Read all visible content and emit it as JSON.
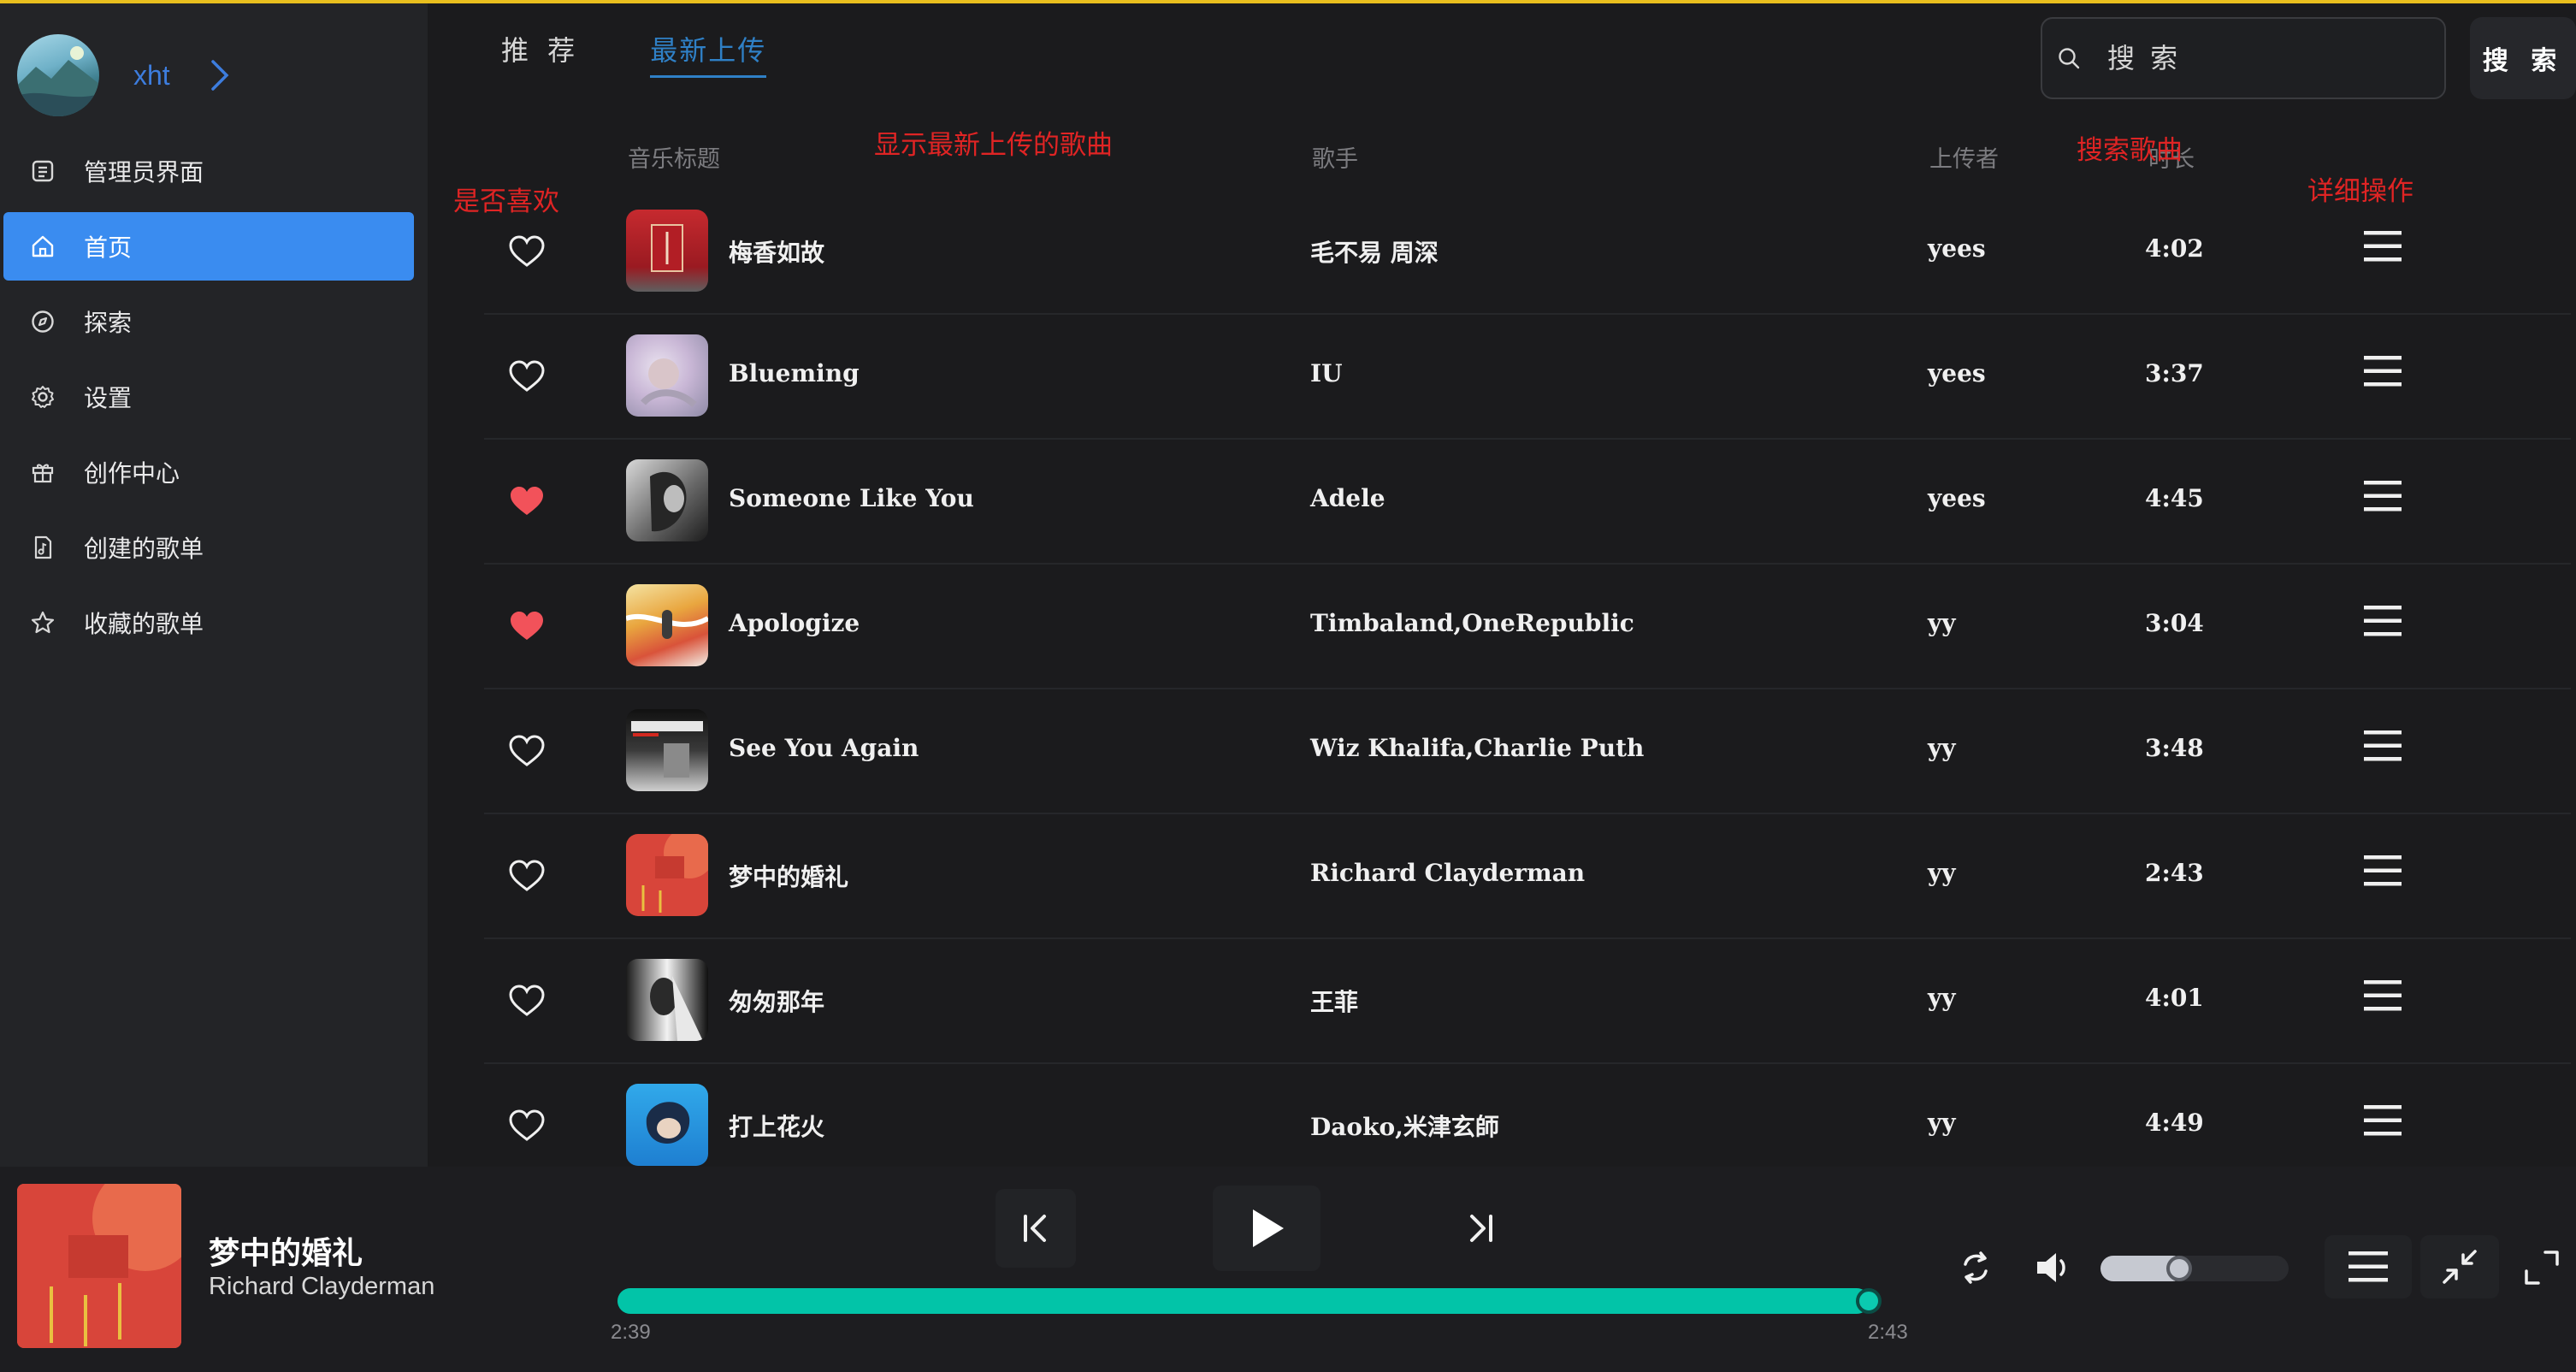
{
  "sidebar": {
    "username": "xht",
    "items": [
      {
        "label": "管理员界面",
        "icon": "admin-list-icon",
        "active": false
      },
      {
        "label": "首页",
        "icon": "home-icon",
        "active": true
      },
      {
        "label": "探索",
        "icon": "compass-icon",
        "active": false
      },
      {
        "label": "设置",
        "icon": "gear-icon",
        "active": false
      },
      {
        "label": "创作中心",
        "icon": "gift-icon",
        "active": false
      },
      {
        "label": "创建的歌单",
        "icon": "music-doc-icon",
        "active": false
      },
      {
        "label": "收藏的歌单",
        "icon": "star-icon",
        "active": false
      }
    ]
  },
  "tabs": [
    {
      "label": "推 荐",
      "active": false
    },
    {
      "label": "最新上传",
      "active": true
    }
  ],
  "search": {
    "placeholder": "搜 索",
    "button_label": "搜 索"
  },
  "table": {
    "headers": {
      "title": "音乐标题",
      "artist": "歌手",
      "uploader": "上传者",
      "duration": "时长"
    },
    "rows": [
      {
        "title": "梅香如故",
        "artist": "毛不易 周深",
        "uploader": "yees",
        "duration": "4:02",
        "liked": false
      },
      {
        "title": "Blueming",
        "artist": "IU",
        "uploader": "yees",
        "duration": "3:37",
        "liked": false
      },
      {
        "title": "Someone Like You",
        "artist": "Adele",
        "uploader": "yees",
        "duration": "4:45",
        "liked": true
      },
      {
        "title": "Apologize",
        "artist": "Timbaland,OneRepublic",
        "uploader": "yy",
        "duration": "3:04",
        "liked": true
      },
      {
        "title": "See You Again",
        "artist": "Wiz Khalifa,Charlie Puth",
        "uploader": "yy",
        "duration": "3:48",
        "liked": false
      },
      {
        "title": "梦中的婚礼",
        "artist": "Richard Clayderman",
        "uploader": "yy",
        "duration": "2:43",
        "liked": false
      },
      {
        "title": "匆匆那年",
        "artist": "王菲",
        "uploader": "yy",
        "duration": "4:01",
        "liked": false
      },
      {
        "title": "打上花火",
        "artist": "Daoko,米津玄師",
        "uploader": "yy",
        "duration": "4:49",
        "liked": false
      }
    ]
  },
  "annotations": {
    "latest": "显示最新上传的歌曲",
    "like": "是否喜欢",
    "search": "搜索歌曲",
    "detail": "详细操作"
  },
  "player": {
    "title": "梦中的婚礼",
    "artist": "Richard Clayderman",
    "current_time": "2:39",
    "total_time": "2:43",
    "progress": 0.98,
    "volume": 0.45
  },
  "colors": {
    "accent": "#3a8cf0",
    "tab_active": "#2f80c6",
    "progress": "#02c4a8",
    "liked": "#f2525a",
    "annotation": "#e02424"
  }
}
